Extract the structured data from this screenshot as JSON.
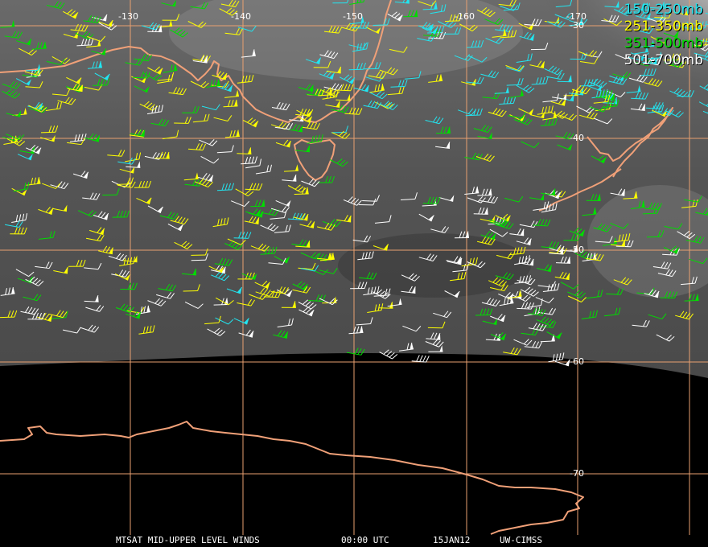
{
  "legend": [
    {
      "label": "150-250mb",
      "color": "#22e5f0"
    },
    {
      "label": "251-350mb",
      "color": "#ffff00"
    },
    {
      "label": "351-500mb",
      "color": "#00dd00"
    },
    {
      "label": "501-700mb",
      "color": "#ffffff"
    }
  ],
  "lon_labels": [
    "-130",
    "-140",
    "-150",
    "-160",
    "-170"
  ],
  "lat_labels": [
    "-30",
    "-40",
    "-50",
    "-60",
    "-70"
  ],
  "footer": {
    "product": "MTSAT MID-UPPER LEVEL WINDS",
    "time": "00:00 UTC",
    "date": "15JAN12",
    "source": "UW-CIMSS"
  },
  "colors": {
    "coastline": "#f0a078",
    "grid": "#e8a070",
    "space": "#000000"
  }
}
